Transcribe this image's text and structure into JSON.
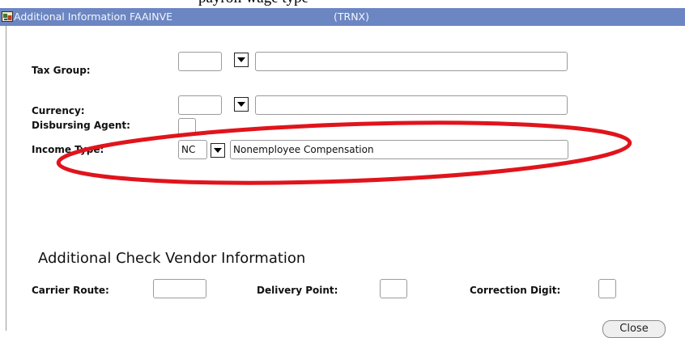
{
  "caption_fragment": "payroll wage type",
  "window": {
    "title": "Additional Information  FAAINVE",
    "form_code": "(TRNX)"
  },
  "fields": {
    "tax_group": {
      "label": "Tax Group:",
      "code": "",
      "description": ""
    },
    "currency": {
      "label": "Currency:",
      "code": "",
      "description": ""
    },
    "disbursing_agent": {
      "label": "Disbursing Agent:",
      "value": ""
    },
    "income_type": {
      "label": "Income Type:",
      "code": "NC",
      "description": "Nonemployee Compensation"
    }
  },
  "check_vendor": {
    "section_title": "Additional Check Vendor Information",
    "carrier_route": {
      "label": "Carrier Route:",
      "value": ""
    },
    "delivery_point": {
      "label": "Delivery Point:",
      "value": ""
    },
    "correction_digit": {
      "label": "Correction Digit:",
      "value": ""
    }
  },
  "buttons": {
    "close": "Close"
  },
  "annotation": {
    "shape": "ellipse",
    "color": "#e0141c",
    "target": "income_type"
  }
}
